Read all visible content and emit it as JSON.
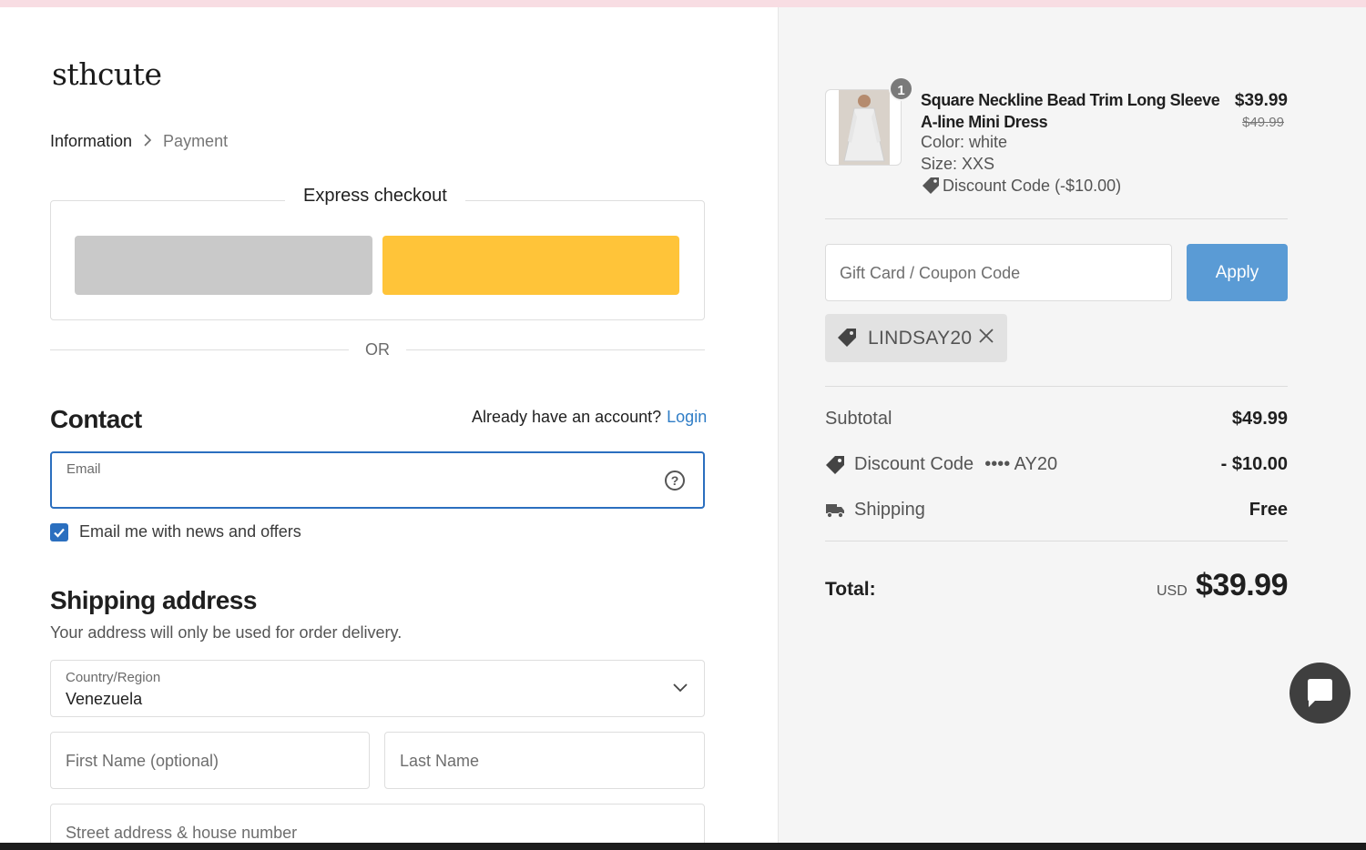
{
  "header": {
    "logo": "sthcute"
  },
  "breadcrumb": {
    "items": [
      "Information",
      "Payment"
    ]
  },
  "express": {
    "title": "Express checkout",
    "or_text": "OR"
  },
  "contact": {
    "heading": "Contact",
    "account_prompt": "Already have an account?",
    "login_label": "Login",
    "email_label": "Email",
    "email_value": "",
    "newsletter_label": "Email me with news and offers",
    "newsletter_checked": true
  },
  "shipping": {
    "heading": "Shipping address",
    "subtext": "Your address will only be used for order delivery.",
    "country_label": "Country/Region",
    "country_value": "Venezuela",
    "first_name_placeholder": "First Name (optional)",
    "last_name_placeholder": "Last Name",
    "street_placeholder": "Street address & house number"
  },
  "order": {
    "product": {
      "quantity": "1",
      "name": "Square Neckline Bead Trim Long Sleeve A-line Mini Dress",
      "color": "Color: white",
      "size": "Size: XXS",
      "discount": "Discount Code (-$10.00)",
      "price": "$39.99",
      "original_price": "$49.99"
    },
    "coupon_placeholder": "Gift Card / Coupon Code",
    "apply_label": "Apply",
    "applied_code": "LINDSAY20",
    "summary": {
      "subtotal_label": "Subtotal",
      "subtotal_value": "$49.99",
      "discount_label": "Discount Code",
      "discount_code_masked": "•••• AY20",
      "discount_value": "- $10.00",
      "shipping_label": "Shipping",
      "shipping_value": "Free",
      "total_label": "Total:",
      "total_currency": "USD",
      "total_value": "$39.99"
    }
  },
  "colors": {
    "accent_blue": "#2b6fbf",
    "apply_blue": "#5a9bd5",
    "paypal_yellow": "#ffc439",
    "link_blue": "#2f7dc6"
  },
  "icons": [
    "chevron-right-icon",
    "help-circle-icon",
    "checkbox-checked-icon",
    "chevron-down-icon",
    "tag-icon",
    "close-icon",
    "truck-icon",
    "chat-icon"
  ]
}
